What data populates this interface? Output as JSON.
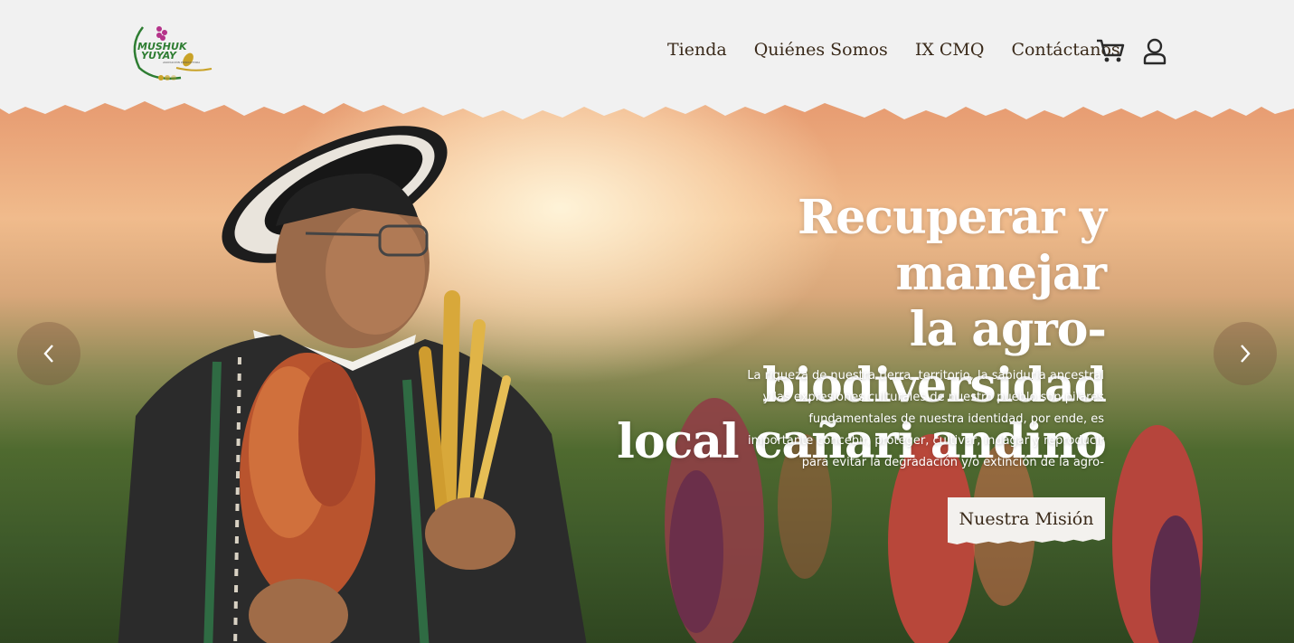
{
  "brand": {
    "logo_line1": "MUSHUK",
    "logo_line2": "YUYAY",
    "logo_small": "ASOCIACIÓN PRODUCTORA"
  },
  "nav": {
    "items": [
      "Tienda",
      "Quiénes Somos",
      "IX CMQ",
      "Contáctanos"
    ],
    "cart_icon": "cart-icon",
    "user_icon": "user-icon"
  },
  "hero": {
    "title_line1": "Recuperar y manejar",
    "title_line2": "la agro-biodiversidad",
    "title_line3": "local cañari andino",
    "desc_line1": "La riqueza de nuestra tierra, territorio, la sabiduría ancestral",
    "desc_line2": "y las expresiones culturales de nuestro pueblo son pilares",
    "desc_line3": "fundamentales de nuestra identidad, por ende, es",
    "desc_line4": "importante concebir, proteger, cultivar, indagar y reproducir",
    "desc_line5": "para evitar la degradación y/o extinción de la agro-",
    "cta_label": "Nuestra Misión"
  },
  "carousel": {
    "prev_icon": "chevron-left-icon",
    "next_icon": "chevron-right-icon"
  },
  "colors": {
    "header_bg": "#f1f1f1",
    "nav_text": "#3a2a1a",
    "logo_green": "#2e7d32",
    "logo_purple": "#b5338a",
    "logo_gold": "#c9a227"
  }
}
